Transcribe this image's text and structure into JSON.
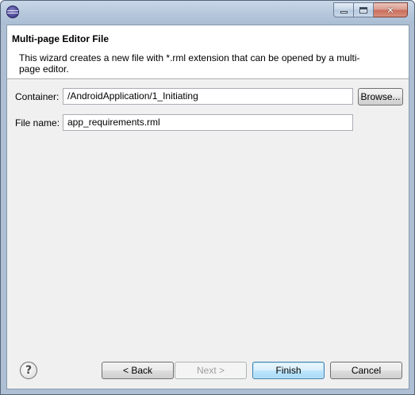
{
  "window": {
    "app_icon": "eclipse-icon",
    "controls": {
      "minimize_icon": "minimize-icon",
      "maximize_icon": "maximize-icon",
      "close_glyph": "✕"
    }
  },
  "header": {
    "title": "Multi-page Editor File",
    "description": "This wizard creates a new file with *.rml extension that can be opened by a multi-page editor."
  },
  "form": {
    "container_label": "Container:",
    "container_value": "/AndroidApplication/1_Initiating",
    "browse_label": "Browse...",
    "filename_label": "File name:",
    "filename_value": "app_requirements.rml"
  },
  "footer": {
    "help_glyph": "?",
    "back_label": "< Back",
    "next_label": "Next >",
    "finish_label": "Finish",
    "cancel_label": "Cancel"
  }
}
